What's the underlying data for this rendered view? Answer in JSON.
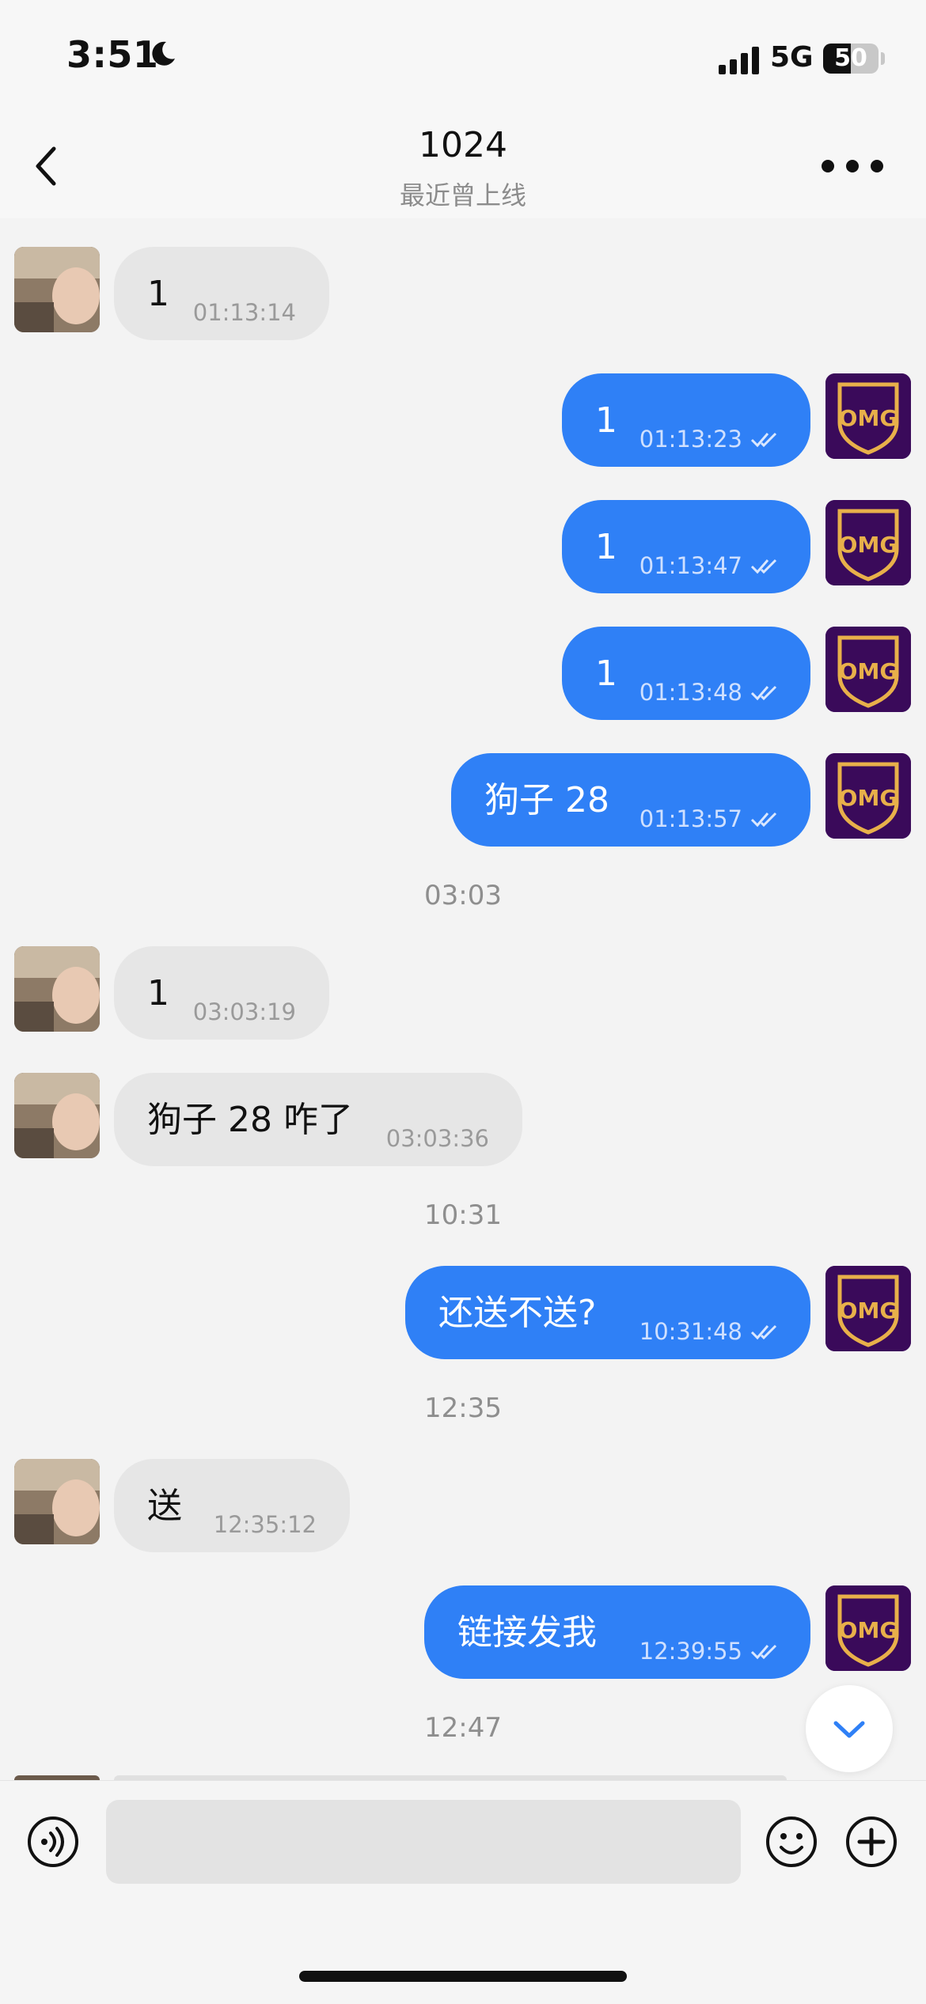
{
  "status_bar": {
    "time": "3:51",
    "network": "5G",
    "battery_percent": 50,
    "battery_label": "50",
    "icons": [
      "moon-icon",
      "signal-icon",
      "battery-icon"
    ]
  },
  "header": {
    "title": "1024",
    "subtitle": "最近曾上线",
    "back_icon": "chevron-left-icon",
    "more_icon": "more-dots-icon"
  },
  "colors": {
    "outgoing_bubble": "#2f80f6",
    "incoming_bubble": "#e6e6e6",
    "background": "#f3f3f3"
  },
  "messages": [
    {
      "direction": "in",
      "text": "1",
      "time": "01:13:14"
    },
    {
      "direction": "out",
      "text": "1",
      "time": "01:13:23",
      "status": "read-double-check"
    },
    {
      "direction": "out",
      "text": "1",
      "time": "01:13:47",
      "status": "read-double-check"
    },
    {
      "direction": "out",
      "text": "1",
      "time": "01:13:48",
      "status": "read-double-check"
    },
    {
      "direction": "out",
      "text": "狗子 28",
      "time": "01:13:57",
      "status": "read-double-check"
    },
    {
      "divider": "03:03"
    },
    {
      "direction": "in",
      "text": "1",
      "time": "03:03:19"
    },
    {
      "direction": "in",
      "text": "狗子 28 咋了",
      "time": "03:03:36"
    },
    {
      "divider": "10:31"
    },
    {
      "direction": "out",
      "text": "还送不送?",
      "time": "10:31:48",
      "status": "read-double-check"
    },
    {
      "divider": "12:35"
    },
    {
      "direction": "in",
      "text": "送",
      "time": "12:35:12"
    },
    {
      "direction": "out",
      "text": "链接发我",
      "time": "12:39:55",
      "status": "read-double-check"
    },
    {
      "divider": "12:47"
    }
  ],
  "avatars": {
    "outgoing_logo_text": "OMG",
    "incoming": "user-photo-avatar"
  },
  "input_bar": {
    "placeholder": "",
    "icons": [
      "voice-icon",
      "emoji-icon",
      "plus-circle-icon"
    ]
  },
  "scroll_button_icon": "chevron-down-icon"
}
